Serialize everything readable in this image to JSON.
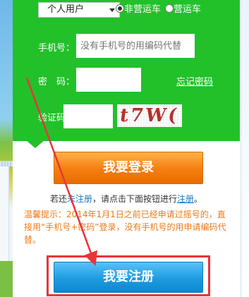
{
  "login": {
    "user_type": {
      "selected": "个人用户",
      "options": [
        "个人用户"
      ]
    },
    "vehicle_type": {
      "options": [
        {
          "label": "非营运车",
          "checked": true
        },
        {
          "label": "营运车",
          "checked": false
        }
      ]
    },
    "phone": {
      "label": "手机号：",
      "placeholder": "没有手机号的用编码代替"
    },
    "password": {
      "label": "密　码：",
      "forgot_link": "忘记密码"
    },
    "captcha": {
      "label": "验证码：",
      "image_text": "t7W("
    },
    "login_button": "我要登录"
  },
  "register": {
    "prefix": "若还",
    "unregistered_link": "未注册",
    "middle": "，请点击下面按钮进行",
    "register_link": "注册",
    "suffix": "。",
    "tip": "温馨提示：2014年1月1日之前已经申请过摇号的，直接用“手机号+密码”登录，没有手机号的用申请编码代替。",
    "register_button": "我要注册"
  },
  "colors": {
    "panel_green": "#22c12a",
    "login_orange": "#f57d0e",
    "register_blue": "#1d9be0",
    "annotation_red": "#e8353a",
    "tip_orange": "#ee7a16"
  }
}
